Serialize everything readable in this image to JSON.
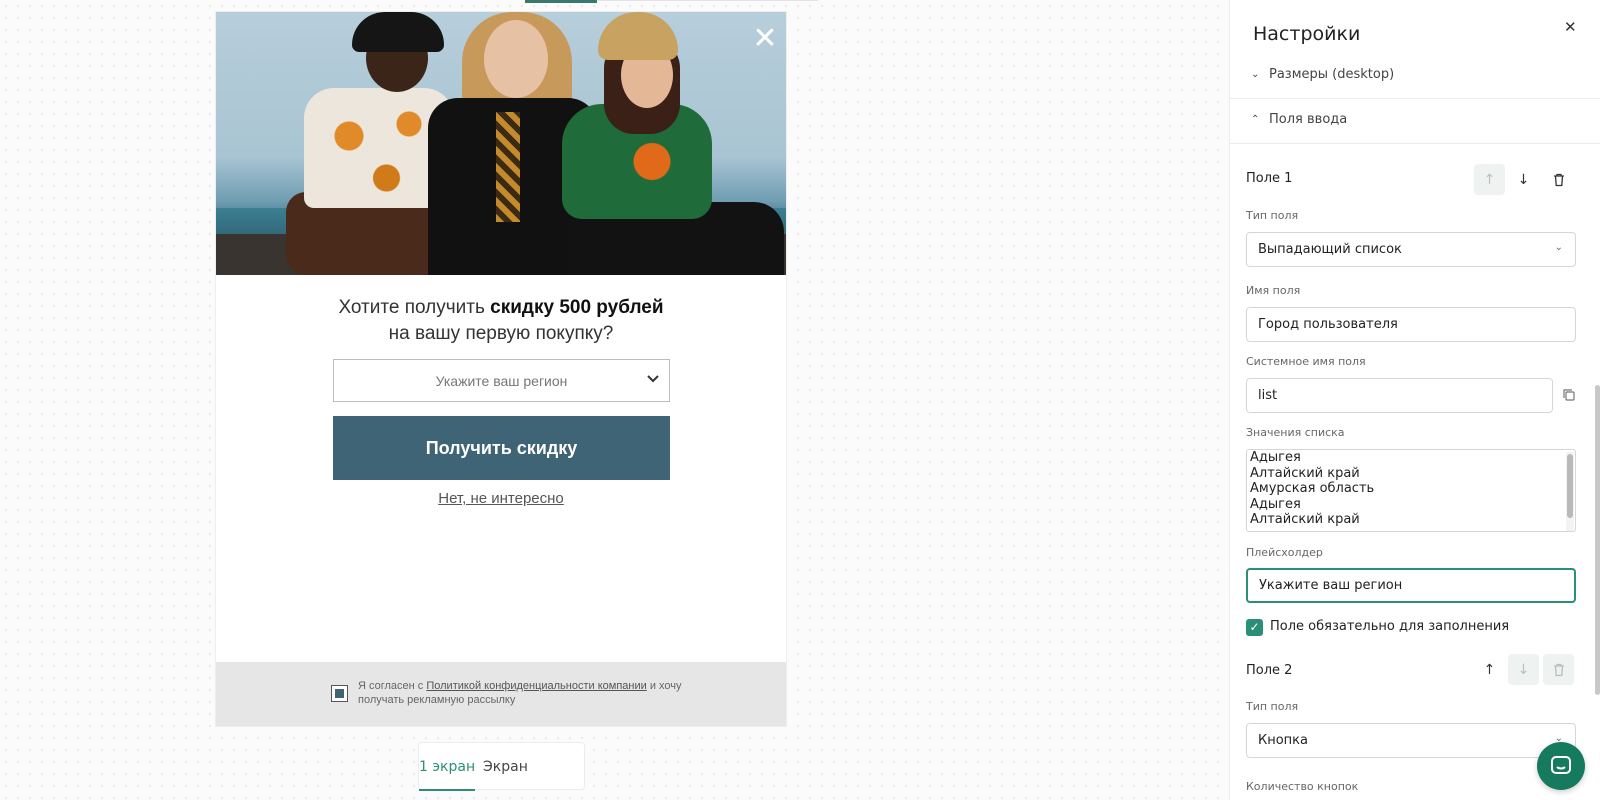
{
  "popup": {
    "headline_prefix": "Хотите получить ",
    "headline_bold": "скидку 500 рублей",
    "headline_line2": "на вашу первую покупку?",
    "region_placeholder": "Укажите ваш регион",
    "cta_label": "Получить скидку",
    "decline_label": "Нет, не интересно",
    "consent_prefix": "Я согласен с ",
    "consent_link": "Политикой конфиденциальности компании",
    "consent_suffix": " и хочу получать рекламную рассылку"
  },
  "screen_tabs": [
    {
      "label": "1 экран",
      "active": true
    },
    {
      "label": "Экран спасибо",
      "active": false
    }
  ],
  "settings": {
    "title": "Настройки",
    "sections": [
      {
        "label": "Размеры (desktop)",
        "expanded": false
      },
      {
        "label": "Поля ввода",
        "expanded": true
      }
    ],
    "field1": {
      "heading": "Поле 1",
      "type_label": "Тип поля",
      "type_value": "Выпадающий список",
      "name_label": "Имя поля",
      "name_value": "Город пользователя",
      "system_label": "Системное имя поля",
      "system_value": "list",
      "values_label": "Значения списка",
      "values": [
        "Адыгея",
        "Алтайский край",
        "Амурская область",
        "Адыгея",
        "Алтайский край"
      ],
      "placeholder_label": "Плейсхолдер",
      "placeholder_value": "Укажите ваш регион",
      "required_label": "Поле обязательно для заполнения"
    },
    "field2": {
      "heading": "Поле 2",
      "type_label": "Тип поля",
      "type_value": "Кнопка",
      "count_label": "Количество кнопок"
    }
  },
  "colors": {
    "accent": "#2a8f76",
    "cta": "#3f6476",
    "chat": "#157a5e"
  }
}
